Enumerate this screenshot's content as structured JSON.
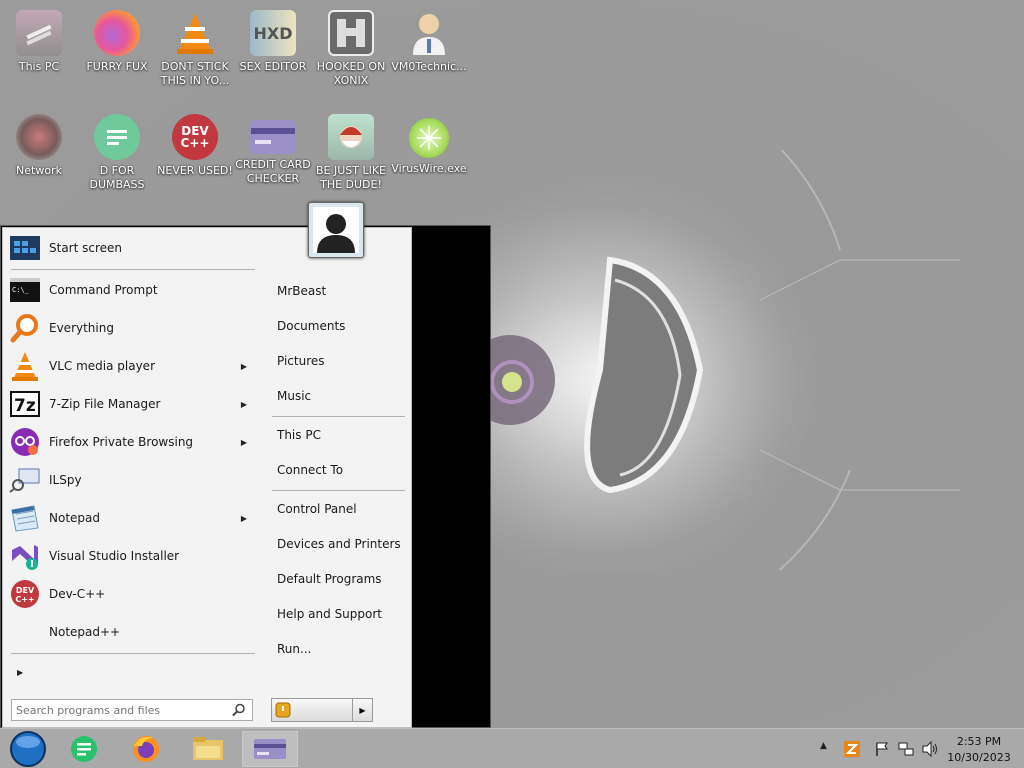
{
  "desktop": {
    "icons": [
      {
        "label": "This PC",
        "icon": "this-pc-icon"
      },
      {
        "label": "FURRY FUX",
        "icon": "firefox-icon"
      },
      {
        "label": "DONT STICK THIS IN YO...",
        "icon": "vlc-icon"
      },
      {
        "label": "SEX EDITOR",
        "icon": "hex-editor-icon"
      },
      {
        "label": "HOOKED ON XONIX",
        "icon": "xonix-icon"
      },
      {
        "label": "VM0Technic...",
        "icon": "doctor-icon"
      },
      {
        "label": "Network",
        "icon": "network-icon"
      },
      {
        "label": "D FOR DUMBASS",
        "icon": "chat-icon"
      },
      {
        "label": "NEVER USED!",
        "icon": "devcpp-icon"
      },
      {
        "label": "CREDIT CARD CHECKER",
        "icon": "credit-card-icon"
      },
      {
        "label": "BE JUST LIKE THE DUDE!",
        "icon": "santa-icon"
      },
      {
        "label": "VirusWire.exe",
        "icon": "lime-icon"
      }
    ]
  },
  "start_menu": {
    "top_item": {
      "label": "Start screen",
      "icon": "start-screen-icon"
    },
    "programs": [
      {
        "label": "Command Prompt",
        "icon": "cmd-icon",
        "submenu": false
      },
      {
        "label": "Everything",
        "icon": "magnifier-icon",
        "submenu": false
      },
      {
        "label": "VLC media player",
        "icon": "vlc-icon",
        "submenu": true
      },
      {
        "label": "7-Zip File Manager",
        "icon": "7zip-icon",
        "submenu": true
      },
      {
        "label": "Firefox Private Browsing",
        "icon": "firefox-private-icon",
        "submenu": true
      },
      {
        "label": "ILSpy",
        "icon": "ilspy-icon",
        "submenu": false
      },
      {
        "label": "Notepad",
        "icon": "notepad-icon",
        "submenu": true
      },
      {
        "label": "Visual Studio Installer",
        "icon": "vs-installer-icon",
        "submenu": false
      },
      {
        "label": "Dev-C++",
        "icon": "devcpp-icon",
        "submenu": false
      },
      {
        "label": "Notepad++",
        "icon": "",
        "submenu": false
      }
    ],
    "right_items": [
      {
        "label": "MrBeast"
      },
      {
        "label": "Documents"
      },
      {
        "label": "Pictures"
      },
      {
        "label": "Music"
      },
      {
        "label": "This PC"
      },
      {
        "label": "Connect To"
      },
      {
        "label": "Control Panel"
      },
      {
        "label": "Devices and Printers"
      },
      {
        "label": "Default Programs"
      },
      {
        "label": "Help and Support"
      },
      {
        "label": "Run..."
      }
    ],
    "search_placeholder": "Search programs and files"
  },
  "taskbar": {
    "pinned": [
      {
        "icon": "start-orb-icon"
      },
      {
        "icon": "chat-icon"
      },
      {
        "icon": "firefox-icon"
      },
      {
        "icon": "file-explorer-icon"
      },
      {
        "icon": "credit-card-icon"
      }
    ],
    "tray": {
      "icons": [
        "show-hidden-icon",
        "app-tray-icon",
        "flag-icon",
        "network-icon",
        "volume-icon"
      ]
    },
    "clock": {
      "time": "2:53 PM",
      "date": "10/30/2023"
    }
  }
}
